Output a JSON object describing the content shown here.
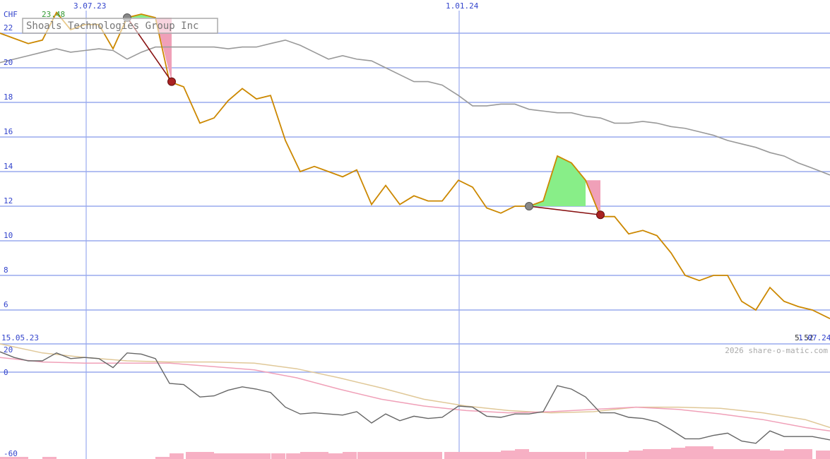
{
  "chart_data": [
    {
      "type": "line",
      "title": "Shoals Technologies Group Inc",
      "currency": "CHF",
      "watermark": "2026 share-o-matic.com",
      "ylim": [
        4,
        24
      ],
      "y_ticks": [
        6,
        8,
        10,
        12,
        14,
        16,
        18,
        20,
        22
      ],
      "date_labels": {
        "start": "15.05.23",
        "mid1": "3.07.23",
        "mid2": "1.01.24",
        "end": "1.07.24"
      },
      "high_label": "23.48",
      "last_label": "5.52",
      "colors": {
        "price": "#cc8800",
        "ma": "#999999",
        "grid": "#99aaee",
        "gain": "#88ee88",
        "loss": "#f0a0b8",
        "trade_line": "#881111",
        "marker_sell": "#aa2222",
        "marker_buy": "#888888"
      },
      "series": [
        {
          "name": "price",
          "x": [
            0,
            20,
            40,
            60,
            80,
            100,
            120,
            140,
            160,
            180,
            200,
            220,
            240,
            260,
            283,
            303,
            323,
            343,
            363,
            383,
            404,
            425,
            445,
            465,
            485,
            505,
            526,
            546,
            566,
            586,
            606,
            626,
            649,
            669,
            689,
            709,
            729,
            749,
            769,
            789,
            809,
            829,
            850,
            870,
            890,
            910,
            930,
            950,
            970,
            990,
            1010,
            1030,
            1050,
            1070,
            1090,
            1110,
            1130,
            1150,
            1175
          ],
          "values": [
            22,
            21.7,
            21.4,
            21.6,
            23.2,
            22.2,
            22.5,
            22.5,
            21.1,
            22.9,
            23.1,
            22.9,
            19.2,
            18.9,
            16.8,
            17.1,
            18.1,
            18.8,
            18.2,
            18.4,
            15.8,
            14.0,
            14.3,
            14.0,
            13.7,
            14.1,
            12.1,
            13.2,
            12.1,
            12.6,
            12.3,
            12.3,
            13.5,
            13.1,
            11.9,
            11.6,
            12.0,
            12.0,
            12.3,
            14.9,
            14.5,
            13.5,
            11.4,
            11.4,
            10.4,
            10.6,
            10.3,
            9.3,
            8.0,
            7.7,
            8.0,
            8.0,
            6.5,
            6.0,
            7.3,
            6.5,
            6.2,
            6.0,
            5.5
          ]
        },
        {
          "name": "moving average",
          "x": [
            0,
            20,
            40,
            60,
            80,
            100,
            120,
            140,
            160,
            180,
            200,
            220,
            240,
            260,
            283,
            303,
            323,
            343,
            363,
            383,
            404,
            425,
            445,
            465,
            485,
            505,
            526,
            546,
            566,
            586,
            606,
            626,
            649,
            669,
            689,
            709,
            729,
            749,
            769,
            789,
            809,
            829,
            850,
            870,
            890,
            910,
            930,
            950,
            970,
            990,
            1010,
            1030,
            1050,
            1070,
            1090,
            1110,
            1130,
            1150,
            1175
          ],
          "values": [
            20.3,
            20.5,
            20.7,
            20.9,
            21.1,
            20.9,
            21.0,
            21.1,
            21.0,
            20.5,
            20.9,
            21.2,
            21.2,
            21.2,
            21.2,
            21.2,
            21.1,
            21.2,
            21.2,
            21.4,
            21.6,
            21.3,
            20.9,
            20.5,
            20.7,
            20.5,
            20.4,
            20.0,
            19.6,
            19.2,
            19.2,
            19.0,
            18.4,
            17.8,
            17.8,
            17.9,
            17.9,
            17.6,
            17.5,
            17.4,
            17.4,
            17.2,
            17.1,
            16.8,
            16.8,
            16.9,
            16.8,
            16.6,
            16.5,
            16.3,
            16.1,
            15.8,
            15.6,
            15.4,
            15.1,
            14.9,
            14.5,
            14.2,
            13.8
          ]
        }
      ],
      "trades": [
        {
          "from": [
            180,
            22.9
          ],
          "to": [
            243,
            19.2
          ],
          "gain_x": [
            180,
            200,
            220
          ],
          "gain_y": [
            22.9,
            23.1,
            22.9
          ],
          "loss_x": [
            220,
            243
          ],
          "loss_y": [
            22.9,
            19.2
          ]
        },
        {
          "from": [
            749,
            12.0
          ],
          "to": [
            850,
            11.5
          ],
          "gain_x": [
            749,
            769,
            789,
            809,
            829
          ],
          "gain_y": [
            12.0,
            12.3,
            14.9,
            14.5,
            13.5
          ],
          "loss_x": [
            829,
            850
          ],
          "loss_y": [
            13.5,
            11.5
          ]
        }
      ]
    },
    {
      "type": "line",
      "ylim": [
        -60,
        20
      ],
      "y_ticks": [
        20,
        0,
        -60
      ],
      "series": [
        {
          "name": "oscillator",
          "x": [
            0,
            20,
            40,
            60,
            80,
            100,
            120,
            140,
            160,
            180,
            200,
            220,
            240,
            260,
            283,
            303,
            323,
            343,
            363,
            383,
            404,
            425,
            445,
            465,
            485,
            505,
            526,
            546,
            566,
            586,
            606,
            626,
            649,
            669,
            689,
            709,
            729,
            749,
            769,
            789,
            809,
            829,
            850,
            870,
            890,
            910,
            930,
            950,
            970,
            990,
            1010,
            1030,
            1050,
            1070,
            1090,
            1110,
            1130,
            1150,
            1175
          ],
          "values": [
            18,
            13,
            10,
            10,
            17,
            12,
            13,
            12,
            4,
            17,
            16,
            12,
            -10,
            -11,
            -22,
            -21,
            -16,
            -13,
            -15,
            -18,
            -31,
            -37,
            -36,
            -37,
            -38,
            -35,
            -45,
            -37,
            -43,
            -39,
            -41,
            -40,
            -30,
            -31,
            -39,
            -40,
            -37,
            -37,
            -35,
            -12,
            -15,
            -22,
            -36,
            -36,
            -40,
            -41,
            -44,
            -51,
            -59,
            -59,
            -56,
            -54,
            -61,
            -63,
            -52,
            -57,
            -57,
            -57,
            -60
          ]
        },
        {
          "name": "signal",
          "x": [
            0,
            60,
            120,
            180,
            240,
            300,
            360,
            420,
            480,
            540,
            600,
            660,
            720,
            780,
            840,
            900,
            960,
            1020,
            1080,
            1140,
            1175
          ],
          "values": [
            13,
            9,
            8,
            8,
            8,
            5,
            2,
            -5,
            -15,
            -24,
            -30,
            -34,
            -36,
            -35,
            -33,
            -31,
            -33,
            -37,
            -42,
            -49,
            -52
          ]
        },
        {
          "name": "trend",
          "x": [
            0,
            60,
            120,
            180,
            240,
            300,
            360,
            420,
            480,
            540,
            600,
            660,
            720,
            780,
            840,
            900,
            960,
            1020,
            1080,
            1140,
            1175
          ],
          "values": [
            25,
            17,
            13,
            10,
            9,
            9,
            8,
            3,
            -5,
            -14,
            -24,
            -30,
            -34,
            -36,
            -35,
            -31,
            -31,
            -32,
            -36,
            -42,
            -49
          ]
        }
      ],
      "colors": {
        "oscillator": "#666666",
        "signal": "#f0a0b8",
        "trend": "#e0c898"
      }
    },
    {
      "type": "bar",
      "x": [
        20,
        40,
        60,
        80,
        100,
        120,
        140,
        160,
        180,
        200,
        220,
        240,
        260,
        283,
        303,
        323,
        343,
        363,
        383,
        404,
        425,
        445,
        465,
        485,
        505,
        526,
        546,
        566,
        586,
        606,
        626,
        649,
        669,
        689,
        709,
        729,
        749,
        769,
        789,
        809,
        829,
        850,
        870,
        890,
        910,
        930,
        950,
        970,
        990,
        1010,
        1030,
        1050,
        1070,
        1090,
        1110,
        1130,
        1150,
        1175
      ],
      "values": [
        3,
        3,
        0,
        3,
        0,
        0,
        0,
        0,
        0,
        0,
        0,
        3,
        8,
        10,
        10,
        8,
        8,
        8,
        8,
        8,
        8,
        10,
        10,
        8,
        10,
        10,
        10,
        10,
        10,
        10,
        10,
        10,
        10,
        10,
        10,
        12,
        14,
        10,
        10,
        10,
        10,
        10,
        10,
        10,
        12,
        14,
        14,
        16,
        18,
        18,
        14,
        14,
        14,
        14,
        12,
        14,
        14,
        12
      ],
      "colors": {
        "bar": "#f7b0c4"
      }
    }
  ]
}
